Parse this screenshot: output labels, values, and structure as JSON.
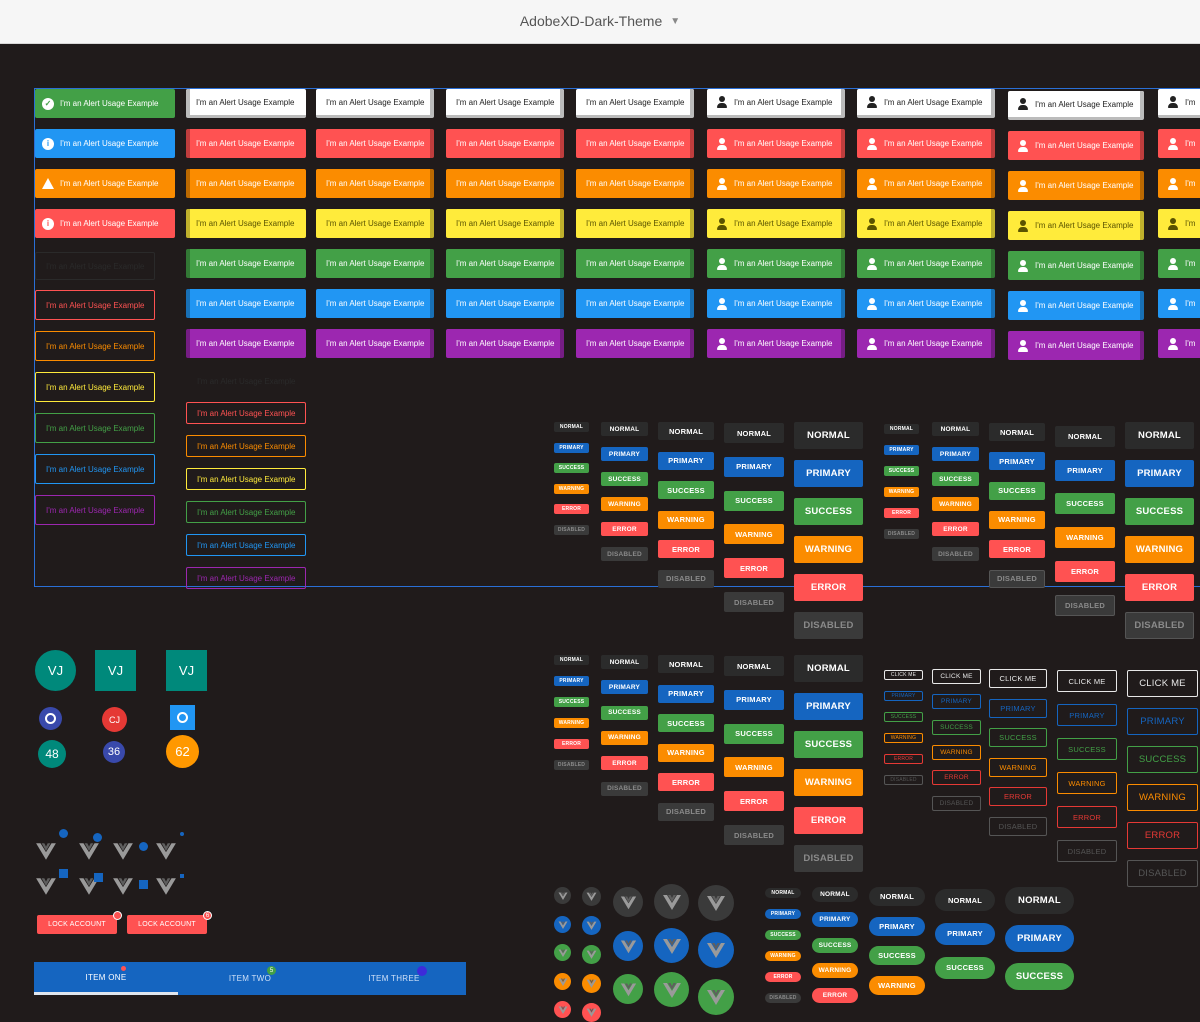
{
  "window": {
    "title": "AdobeXD-Dark-Theme"
  },
  "colors": {
    "success": "#43a047",
    "info": "#2196f3",
    "warning": "#fb8c00",
    "error": "#ff5252",
    "yellow": "#ffeb3b",
    "purple": "#9c27b0",
    "primary": "#1565c0",
    "teal": "#00897b",
    "indigo": "#3949ab",
    "orange": "#ff9800",
    "normal": "#2b2b2b"
  },
  "alert": {
    "text": "I'm an Alert Usage Example",
    "partial_text": "I'm"
  },
  "buttons": {
    "normal": "NORMAL",
    "primary": "PRIMARY",
    "success": "SUCCESS",
    "warning": "WARNING",
    "error": "ERROR",
    "disabled": "DISABLED",
    "click_me": "CLICK ME",
    "lock_account": "LOCK ACCOUNT"
  },
  "avatars": {
    "initials_large": "VJ",
    "initials_small": "CJ",
    "counts": [
      "48",
      "36",
      "62"
    ]
  },
  "badges": {
    "lock_badge": "6",
    "tab_two_badge": "5"
  },
  "tabs": [
    "ITEM ONE",
    "ITEM TWO",
    "ITEM THREE"
  ]
}
